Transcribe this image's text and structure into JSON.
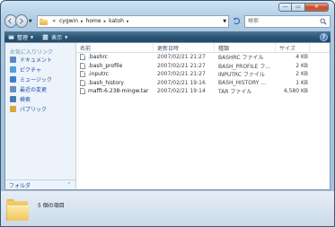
{
  "window": {
    "caption_buttons": {
      "minimize": "—",
      "maximize": "▭",
      "close": "✕"
    }
  },
  "navigation": {
    "path": [
      "cygwin",
      "home",
      "katoh"
    ],
    "overflow_marker": "«",
    "search_placeholder": "検索"
  },
  "toolbar": {
    "organize_label": "整理",
    "views_label": "表示",
    "help_label": "?"
  },
  "sidebar": {
    "favorites_title": "お気に入りリンク",
    "items": [
      {
        "label": "ドキュメント",
        "icon": "documents-icon",
        "color": "#5d86c7"
      },
      {
        "label": "ピクチャ",
        "icon": "pictures-icon",
        "color": "#4fa0d8"
      },
      {
        "label": "ミュージック",
        "icon": "music-icon",
        "color": "#3c7fd0"
      },
      {
        "label": "最近の変更",
        "icon": "recent-icon",
        "color": "#6c8fb8"
      },
      {
        "label": "検索",
        "icon": "search-icon",
        "color": "#4a78b0"
      },
      {
        "label": "パブリック",
        "icon": "public-icon",
        "color": "#d7a93a"
      }
    ],
    "folders_label": "フォルダ",
    "folders_chevron": "⌃"
  },
  "file_list": {
    "columns": [
      "名前",
      "更新日時",
      "種類",
      "サイズ"
    ],
    "rows": [
      {
        "name": ".bashrc",
        "modified": "2007/02/21 21:27",
        "type": "BASHRC ファイル",
        "size": "4 KB"
      },
      {
        "name": ".bash_profile",
        "modified": "2007/02/21 21:27",
        "type": "BASH_PROFILE フ...",
        "size": "2 KB"
      },
      {
        "name": ".inputrc",
        "modified": "2007/02/21 21:27",
        "type": "INPUTRC ファイル",
        "size": "2 KB"
      },
      {
        "name": ".bash_history",
        "modified": "2007/02/21 19:16",
        "type": "BASH_HISTORY ...",
        "size": "1 KB"
      },
      {
        "name": "mafft-6.238-mingw.tar",
        "modified": "2007/02/21 19:14",
        "type": "TAR ファイル",
        "size": "4,580 KB"
      }
    ]
  },
  "details": {
    "item_count": "5 個の項目"
  }
}
